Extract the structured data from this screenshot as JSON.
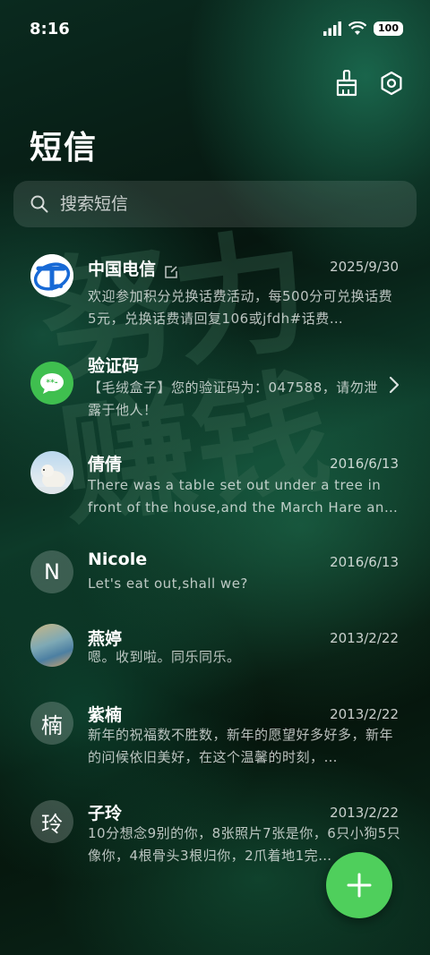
{
  "status_bar": {
    "time": "8:16",
    "battery": "100"
  },
  "header": {
    "title": "短信"
  },
  "search": {
    "placeholder": "搜索短信"
  },
  "watermark": {
    "text": "努力赚钱"
  },
  "conversations": [
    {
      "name": "中国电信",
      "date": "2025/9/30",
      "preview": "欢迎参加积分兑换话费活动，每500分可兑换话费5元，兑换话费请回复106或jfdh#话费…",
      "avatar_icon": "china-telecom-logo-icon"
    },
    {
      "name": "验证码",
      "date": "",
      "preview": "【毛绒盒子】您的验证码为：047588，请勿泄露于他人！",
      "avatar_icon": "message-bubble-icon"
    },
    {
      "name": "倩倩",
      "date": "2016/6/13",
      "preview": "There was a table set out under a tree in front of the house,and the March Hare an…",
      "avatar_icon": "polar-bear-photo-icon"
    },
    {
      "name": "Nicole",
      "date": "2016/6/13",
      "preview": "Let's eat out,shall we?",
      "avatar_letter": "N"
    },
    {
      "name": "燕婷",
      "date": "2013/2/22",
      "preview": "嗯。收到啦。同乐同乐。",
      "avatar_icon": "painting-photo-icon"
    },
    {
      "name": "紫楠",
      "date": "2013/2/22",
      "preview": "新年的祝福数不胜数，新年的愿望好多好多，新年的问候依旧美好，在这个温馨的时刻，…",
      "avatar_letter": "楠"
    },
    {
      "name": "子玲",
      "date": "2013/2/22",
      "preview": "10分想念9别的你，8张照片7张是你，6只小狗5只像你，4根骨头3根归你，2爪着地1完…",
      "avatar_letter": "玲"
    }
  ],
  "colors": {
    "fab": "#4fcf5c",
    "telecom": "#1769d6",
    "verification": "#3fbf4f"
  }
}
